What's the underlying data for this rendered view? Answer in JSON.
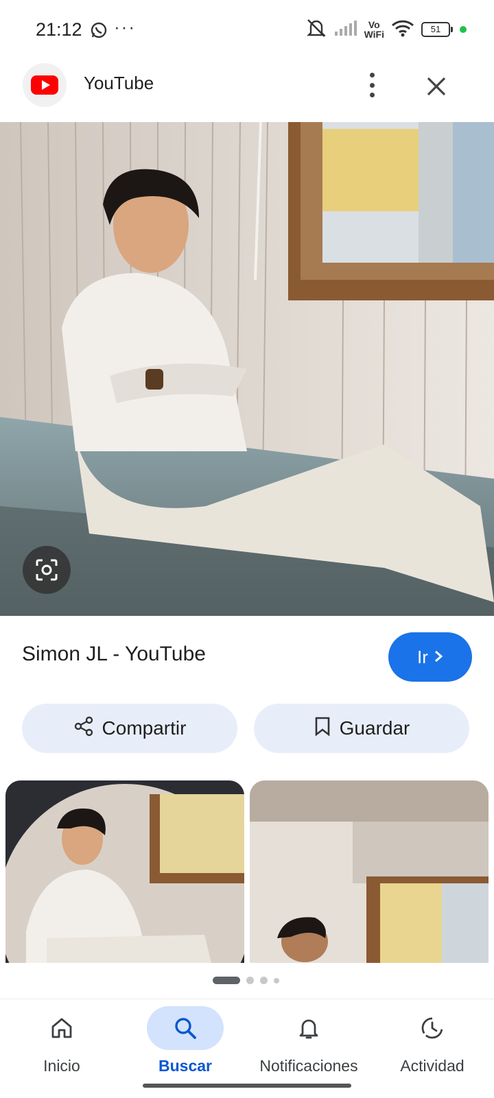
{
  "status_bar": {
    "time": "21:12",
    "more": "···",
    "vowifi": "Vo\nWiFi",
    "battery": "51",
    "icons": [
      "whatsapp-icon",
      "mute-icon",
      "signal-icon",
      "wifi-icon",
      "battery-icon"
    ]
  },
  "header": {
    "site_name": "YouTube",
    "icons": [
      "youtube-logo",
      "more-vert-icon",
      "close-icon"
    ]
  },
  "result": {
    "title": "Simon JL - YouTube",
    "go_label": "Ir"
  },
  "actions": {
    "share_label": "Compartir",
    "save_label": "Guardar"
  },
  "carousel": {
    "current_page": 1,
    "total_pages": 4
  },
  "bottom_nav": {
    "items": [
      {
        "label": "Inicio",
        "icon": "home-icon"
      },
      {
        "label": "Buscar",
        "icon": "search-icon",
        "active": true
      },
      {
        "label": "Notificaciones",
        "icon": "bell-icon"
      },
      {
        "label": "Actividad",
        "icon": "activity-icon"
      }
    ]
  },
  "colors": {
    "accent": "#1a73e8",
    "nav_active_bg": "#d3e3fd",
    "action_bg": "#e8eef9",
    "youtube_red": "#ff0000"
  }
}
